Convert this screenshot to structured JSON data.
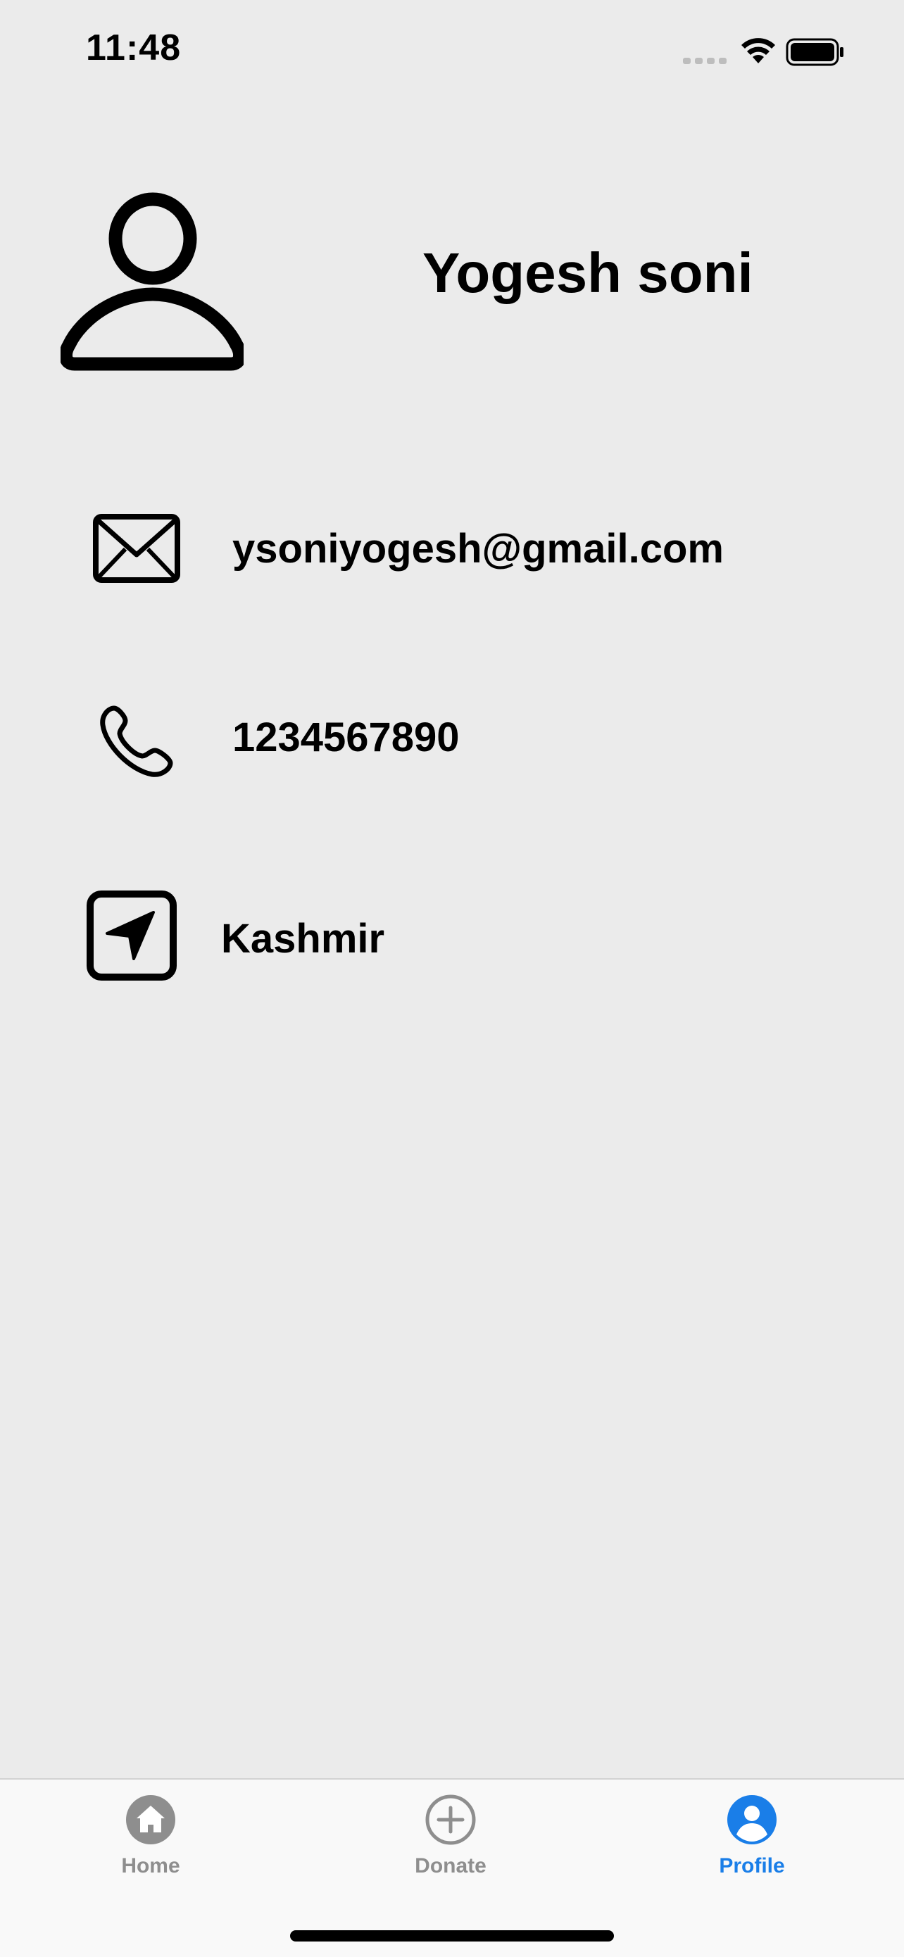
{
  "status_bar": {
    "time": "11:48"
  },
  "profile": {
    "name": "Yogesh soni",
    "email": "ysoniyogesh@gmail.com",
    "phone": "1234567890",
    "location": "Kashmir"
  },
  "icons": {
    "avatar": "person-outline-icon",
    "email": "envelope-icon",
    "phone": "phone-icon",
    "location": "location-arrow-square-icon"
  },
  "tab_bar": {
    "tabs": [
      {
        "label": "Home",
        "icon": "house-circle-icon",
        "selected": false
      },
      {
        "label": "Donate",
        "icon": "plus-circle-icon",
        "selected": false
      },
      {
        "label": "Profile",
        "icon": "person-circle-icon",
        "selected": true
      }
    ]
  },
  "colors": {
    "background": "#ebebeb",
    "accent": "#1a7ee8",
    "inactive_tab": "#8e8e8e",
    "text": "#000000"
  }
}
